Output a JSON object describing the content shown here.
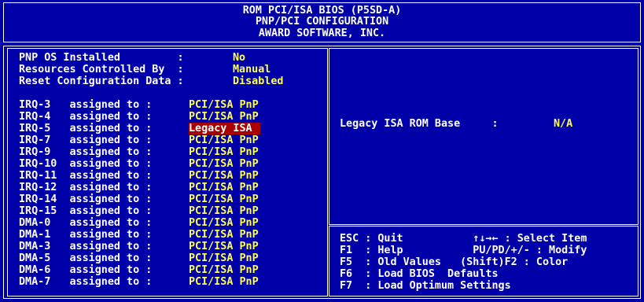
{
  "header": {
    "line1": "ROM PCI/ISA BIOS (P5SD-A)",
    "line2": "PNP/PCI CONFIGURATION",
    "line3": "AWARD SOFTWARE, INC."
  },
  "settings": [
    {
      "label": "PNP OS Installed         :",
      "value": "No"
    },
    {
      "label": "Resources Controlled By  :",
      "value": "Manual"
    },
    {
      "label": "Reset Configuration Data :",
      "value": "Disabled"
    }
  ],
  "irq_assignments": [
    {
      "label": "IRQ-3   assigned to :",
      "value": "PCI/ISA PnP",
      "selected": false
    },
    {
      "label": "IRQ-4   assigned to :",
      "value": "PCI/ISA PnP",
      "selected": false
    },
    {
      "label": "IRQ-5   assigned to :",
      "value": "Legacy ISA",
      "selected": true
    },
    {
      "label": "IRQ-7   assigned to :",
      "value": "PCI/ISA PnP",
      "selected": false
    },
    {
      "label": "IRQ-9   assigned to :",
      "value": "PCI/ISA PnP",
      "selected": false
    },
    {
      "label": "IRQ-10  assigned to :",
      "value": "PCI/ISA PnP",
      "selected": false
    },
    {
      "label": "IRQ-11  assigned to :",
      "value": "PCI/ISA PnP",
      "selected": false
    },
    {
      "label": "IRQ-12  assigned to :",
      "value": "PCI/ISA PnP",
      "selected": false
    },
    {
      "label": "IRQ-14  assigned to :",
      "value": "PCI/ISA PnP",
      "selected": false
    },
    {
      "label": "IRQ-15  assigned to :",
      "value": "PCI/ISA PnP",
      "selected": false
    },
    {
      "label": "DMA-0   assigned to :",
      "value": "PCI/ISA PnP",
      "selected": false
    },
    {
      "label": "DMA-1   assigned to :",
      "value": "PCI/ISA PnP",
      "selected": false
    },
    {
      "label": "DMA-3   assigned to :",
      "value": "PCI/ISA PnP",
      "selected": false
    },
    {
      "label": "DMA-5   assigned to :",
      "value": "PCI/ISA PnP",
      "selected": false
    },
    {
      "label": "DMA-6   assigned to :",
      "value": "PCI/ISA PnP",
      "selected": false
    },
    {
      "label": "DMA-7   assigned to :",
      "value": "PCI/ISA PnP",
      "selected": false
    }
  ],
  "legacy_rom": {
    "label": "Legacy ISA ROM Base     :",
    "value": "N/A"
  },
  "key_help": [
    "ESC : Quit           ↑↓→← : Select Item",
    "F1  : Help           PU/PD/+/- : Modify",
    "F5  : Old Values   (Shift)F2 : Color",
    "F6  : Load BIOS  Defaults",
    "F7  : Load Optimum Settings"
  ],
  "colors": {
    "background": "#0000a8",
    "value_text": "#ffff54",
    "selection": "#a80000",
    "text": "#ffffff"
  }
}
